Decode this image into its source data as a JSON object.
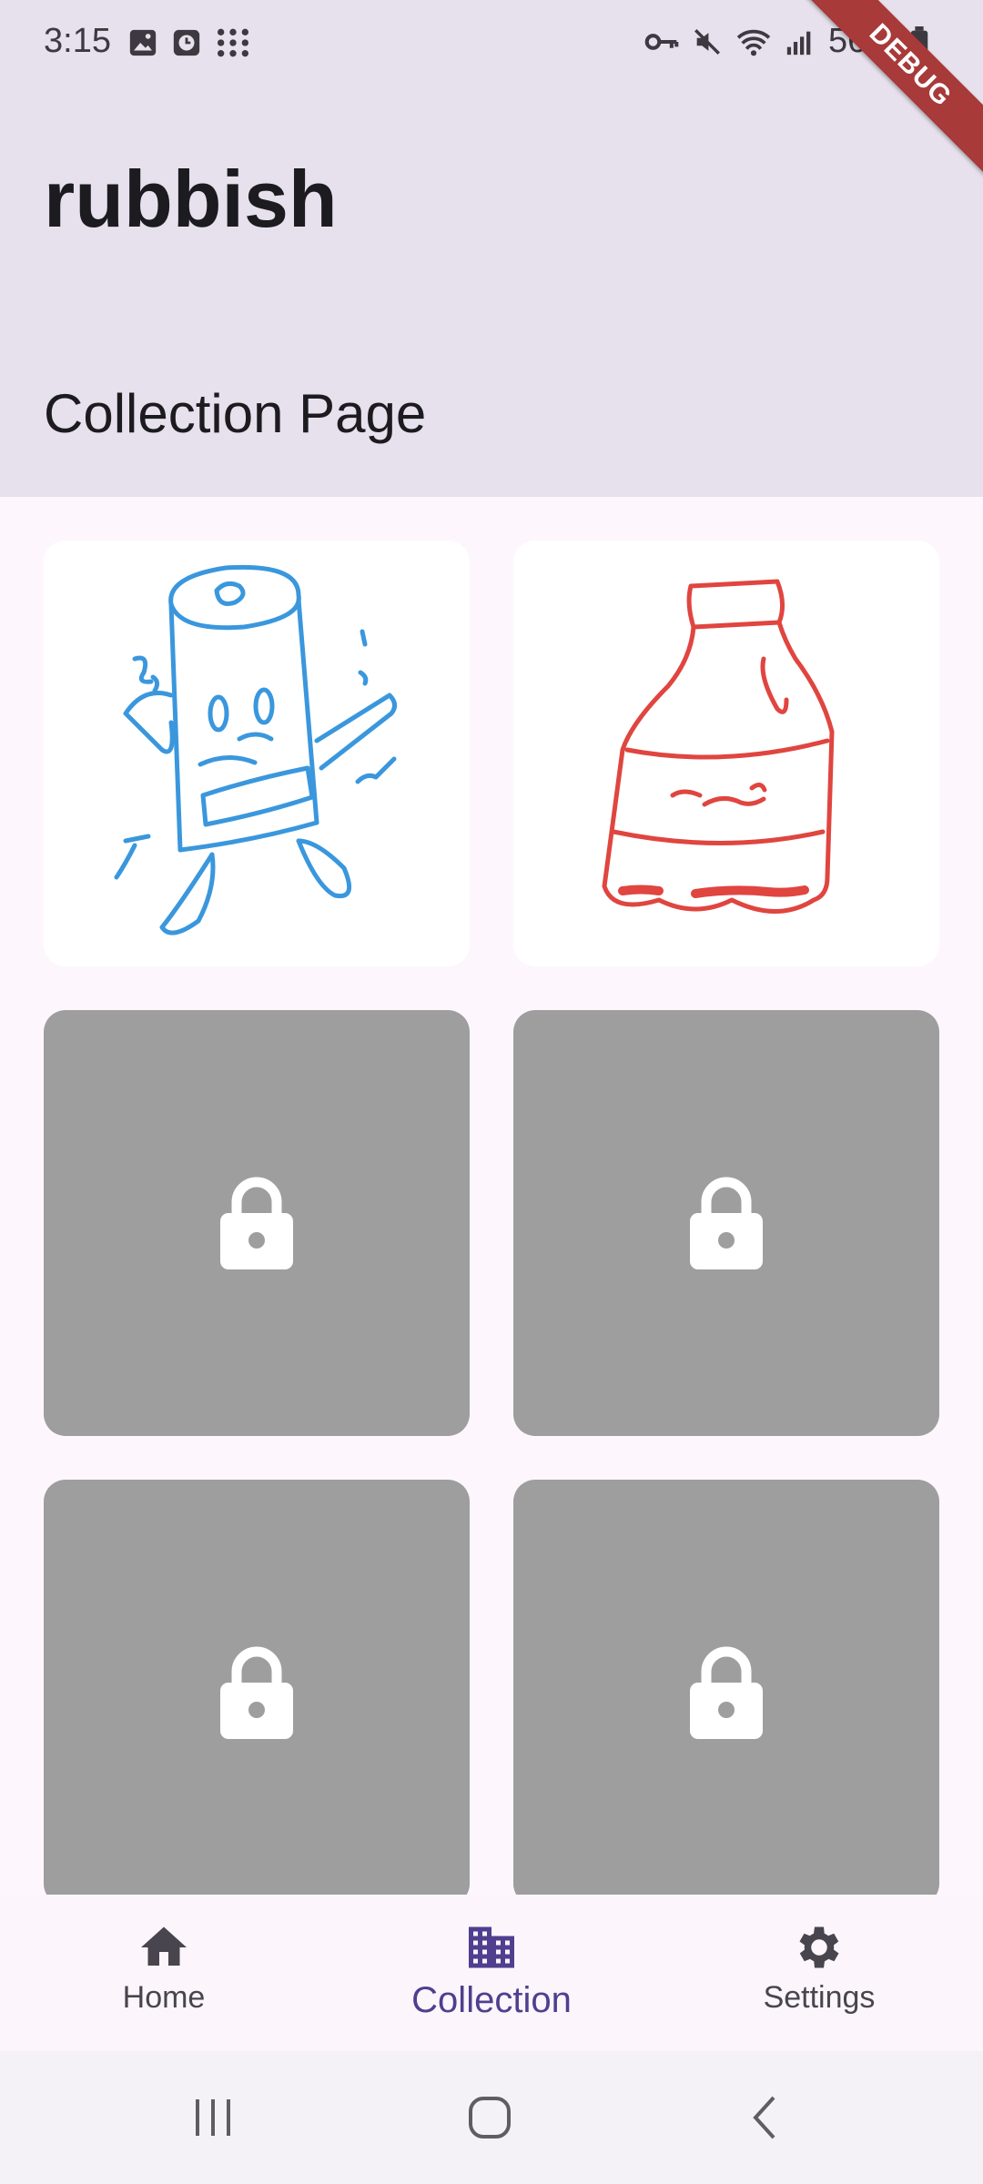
{
  "status_bar": {
    "time": "3:15",
    "battery_text": "56%",
    "debug_label": "DEBUG",
    "left_icons": [
      "image-icon",
      "alarm-icon",
      "apps-grid-icon"
    ],
    "right_icons": [
      "key-icon",
      "mute-icon",
      "wifi-icon",
      "signal-icon",
      "battery-icon"
    ]
  },
  "header": {
    "title": "rubbish",
    "subtitle": "Collection Page"
  },
  "collection": {
    "tiles": [
      {
        "state": "unlocked",
        "art": "battery-drawing"
      },
      {
        "state": "unlocked",
        "art": "bottle-drawing"
      },
      {
        "state": "locked",
        "icon": "lock-icon"
      },
      {
        "state": "locked",
        "icon": "lock-icon"
      },
      {
        "state": "locked",
        "icon": "lock-icon"
      },
      {
        "state": "locked",
        "icon": "lock-icon"
      }
    ]
  },
  "bottom_nav": {
    "items": [
      {
        "label": "Home",
        "icon": "home-icon",
        "active": false
      },
      {
        "label": "Collection",
        "icon": "collection-icon",
        "active": true
      },
      {
        "label": "Settings",
        "icon": "settings-icon",
        "active": false
      }
    ]
  },
  "colors": {
    "header_bg": "#e7e1ee",
    "page_bg": "#fdf7fd",
    "locked_tile": "#9e9e9e",
    "active_nav": "#4f3f8f",
    "battery_ink": "#3a97dd",
    "bottle_ink": "#e0453f"
  }
}
